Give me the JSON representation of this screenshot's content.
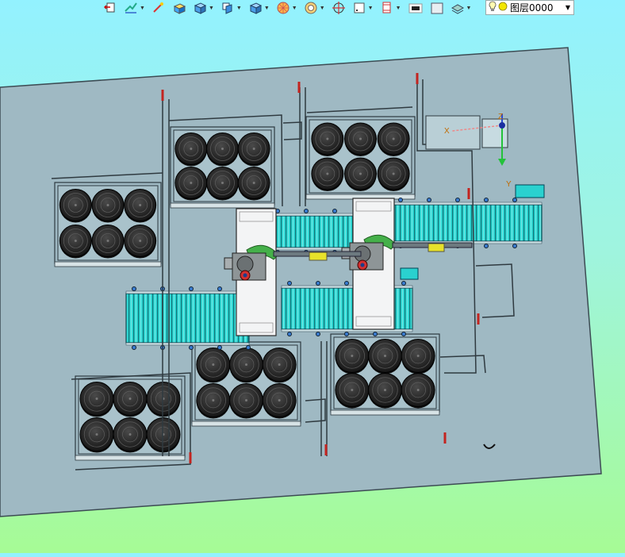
{
  "toolbar": {
    "buttons": [
      {
        "name": "exit-sketch-icon",
        "has_dropdown": false
      },
      {
        "name": "smart-dimension-icon",
        "has_dropdown": true
      },
      {
        "name": "line-tool-icon",
        "has_dropdown": false
      },
      {
        "name": "extrude-icon",
        "has_dropdown": false
      },
      {
        "name": "view-cube-icon",
        "has_dropdown": true
      },
      {
        "name": "view-orientation-icon",
        "has_dropdown": true
      },
      {
        "name": "section-view-icon",
        "has_dropdown": true
      },
      {
        "name": "display-style-icon",
        "has_dropdown": true
      },
      {
        "name": "hide-show-icon",
        "has_dropdown": true
      },
      {
        "name": "sketch-icon",
        "has_dropdown": false
      },
      {
        "name": "dimension-icon",
        "has_dropdown": true
      },
      {
        "name": "appearance-icon",
        "has_dropdown": true
      },
      {
        "name": "line-color-icon",
        "has_dropdown": false
      },
      {
        "name": "fill-color-icon",
        "has_dropdown": false
      },
      {
        "name": "layers-icon",
        "has_dropdown": true
      }
    ],
    "layer_select": {
      "value": "图层0000",
      "bulb_icon": "lightbulb-icon",
      "status_icon": "yellow-circle-icon"
    }
  },
  "viewport": {
    "background_top": "#93f2ff",
    "background_bottom": "#a6fb95",
    "floor_color": "#9fb9c3",
    "roller_color": "#2ad1cf",
    "tire_color": "#2b2b2b",
    "triad": {
      "z_label": "Z",
      "y_label": "Y",
      "x_label": "X"
    }
  }
}
